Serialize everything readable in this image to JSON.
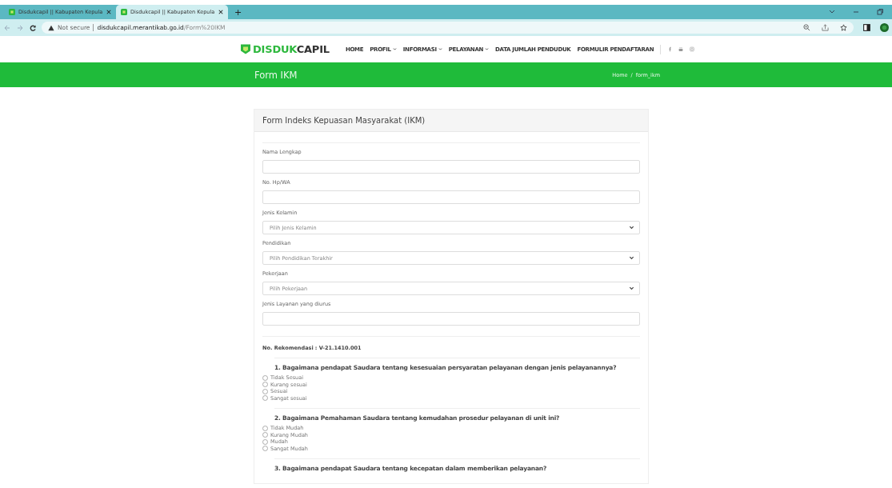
{
  "browser": {
    "tabs": [
      {
        "title": "Disdukcapil || Kabupaten Kepula",
        "selected": false
      },
      {
        "title": "Disdukcapil || Kabupaten Kepula",
        "selected": true
      }
    ],
    "new_tab": "+",
    "address": {
      "security": "Not secure",
      "host": "disdukcapil.merantikab.go.id",
      "path": "/Form%20IKM"
    }
  },
  "nav": {
    "logo": {
      "part_1": "DISDUK",
      "part_2": "CAPIL"
    },
    "items": [
      {
        "label": "HOME",
        "dropdown": false
      },
      {
        "label": "PROFIL",
        "dropdown": true
      },
      {
        "label": "INFORMASI",
        "dropdown": true
      },
      {
        "label": "PELAYANAN",
        "dropdown": true
      },
      {
        "label": "DATA JUMLAH PENDUDUK",
        "dropdown": false
      },
      {
        "label": "FORMULIR PENDAFTARAN",
        "dropdown": false
      }
    ]
  },
  "banner": {
    "title": "Form IKM",
    "breadcrumb": [
      "Home",
      "form_ikm"
    ],
    "separator": "/"
  },
  "form": {
    "title": "Form Indeks Kepuasan Masyarakat (IKM)",
    "fields": [
      {
        "label": "Nama Lengkap",
        "kind": "text"
      },
      {
        "label": "No. Hp/WA",
        "kind": "text"
      },
      {
        "label": "Jenis Kelamin",
        "kind": "select",
        "placeholder": "Pilih Jenis Kelamin"
      },
      {
        "label": "Pendidikan",
        "kind": "select",
        "placeholder": "Pilih Pendidikan Terakhir"
      },
      {
        "label": "Pekerjaan",
        "kind": "select",
        "placeholder": "Pilih Pekerjaan"
      },
      {
        "label": "Jenis Layanan yang diurus",
        "kind": "text"
      }
    ],
    "recommendation": "No. Rekomendasi : V-21.1410.001",
    "questions": [
      {
        "text": "1. Bagaimana pendapat Saudara tentang kesesuaian persyaratan pelayanan dengan jenis pelayanannya?",
        "options": [
          {
            "label": "Tidak Sesuai",
            "selected": false
          },
          {
            "label": "Kurang sesuai",
            "selected": false
          },
          {
            "label": "Sesuai",
            "selected": false
          },
          {
            "label": "Sangat sesuai",
            "selected": false
          }
        ]
      },
      {
        "text": "2. Bagaimana Pemahaman Saudara tentang kemudahan prosedur pelayanan di unit ini?",
        "options": [
          {
            "label": "Tidak Mudah",
            "selected": false
          },
          {
            "label": "Kurang Mudah",
            "selected": false
          },
          {
            "label": "Mudah",
            "selected": false
          },
          {
            "label": "Sangat Mudah",
            "selected": false
          }
        ]
      },
      {
        "text": "3. Bagaimana pendapat Saudara tentang kecepatan dalam memberikan pelayanan?"
      }
    ]
  }
}
